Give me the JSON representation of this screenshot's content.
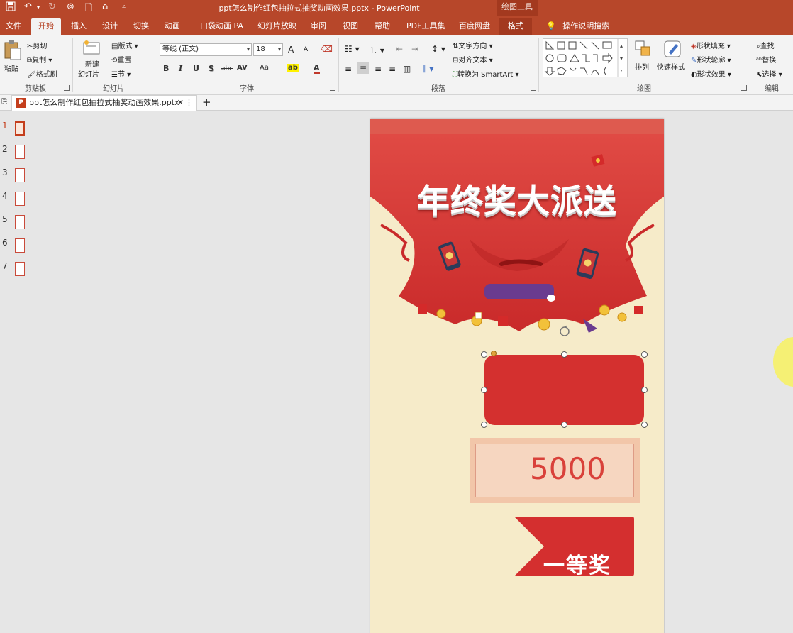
{
  "window": {
    "title": "ppt怎么制作红包抽拉式抽奖动画效果.pptx  -  PowerPoint",
    "context_group": "绘图工具"
  },
  "tabs": [
    {
      "label": "文件",
      "key": "file"
    },
    {
      "label": "开始",
      "key": "home",
      "active": true
    },
    {
      "label": "插入",
      "key": "insert"
    },
    {
      "label": "设计",
      "key": "design"
    },
    {
      "label": "切换",
      "key": "transitions"
    },
    {
      "label": "动画",
      "key": "animations"
    },
    {
      "label": "口袋动画 PA",
      "key": "pa"
    },
    {
      "label": "幻灯片放映",
      "key": "slideshow"
    },
    {
      "label": "审阅",
      "key": "review"
    },
    {
      "label": "视图",
      "key": "view"
    },
    {
      "label": "帮助",
      "key": "help"
    },
    {
      "label": "PDF工具集",
      "key": "pdf"
    },
    {
      "label": "百度网盘",
      "key": "baidu"
    },
    {
      "label": "格式",
      "key": "format"
    }
  ],
  "tell_me": "操作说明搜索",
  "ribbon": {
    "clipboard": {
      "paste": "粘贴",
      "cut": "剪切",
      "copy": "复制",
      "format_painter": "格式刷",
      "group": "剪贴板"
    },
    "slides": {
      "new_slide_1": "新建",
      "new_slide_2": "幻灯片",
      "layout": "版式",
      "reset": "重置",
      "section": "节",
      "group": "幻灯片"
    },
    "font": {
      "name": "等线 (正文)",
      "size": "18",
      "group": "字体",
      "bold": "B",
      "italic": "I",
      "underline": "U",
      "shadow": "S",
      "strike": "abc",
      "spacing": "AV",
      "case": "Aa",
      "highlight": "ab",
      "color": "A",
      "grow": "A",
      "shrink": "A"
    },
    "paragraph": {
      "text_direction": "文字方向",
      "align_text": "对齐文本",
      "smartart": "转换为 SmartArt",
      "group": "段落"
    },
    "drawing": {
      "arrange": "排列",
      "quick_styles": "快速样式",
      "fill": "形状填充",
      "outline": "形状轮廓",
      "effects": "形状效果",
      "group": "绘图"
    },
    "editing": {
      "find": "查找",
      "replace": "替换",
      "select": "选择",
      "group": "编辑"
    }
  },
  "doc_tab": {
    "name": "ppt怎么制作红包抽拉式抽奖动画效果.pptx"
  },
  "thumbnails": [
    "1",
    "2",
    "3",
    "4",
    "5",
    "6",
    "7"
  ],
  "slide": {
    "headline": "年终奖大派送",
    "prize_amount": "5000",
    "award": "一等奖"
  },
  "colors": {
    "accent": "#b7472a",
    "red": "#d4302f",
    "cream": "#f6ebc9"
  }
}
